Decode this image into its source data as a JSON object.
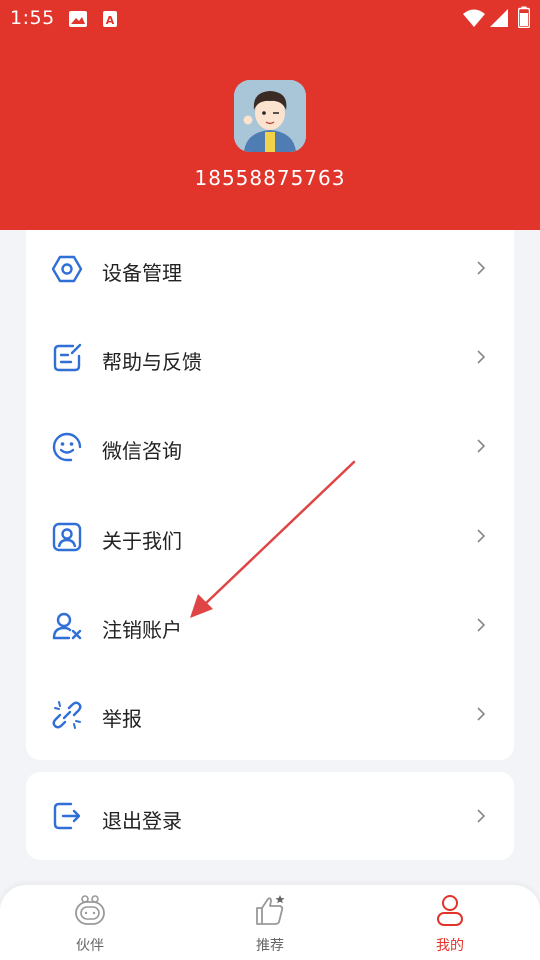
{
  "status_bar": {
    "time": "1:55",
    "icons": [
      "image-icon",
      "app-a-icon",
      "wifi-icon",
      "signal-icon",
      "battery-icon"
    ]
  },
  "colors": {
    "brand_red": "#e1342b",
    "icon_blue": "#2f6fd6",
    "background": "#f3f4f7"
  },
  "profile": {
    "phone": "18558875763"
  },
  "menu": {
    "items": [
      {
        "label": "设备管理",
        "icon": "hexagon-settings-icon"
      },
      {
        "label": "帮助与反馈",
        "icon": "feedback-edit-icon"
      },
      {
        "label": "微信咨询",
        "icon": "smile-chat-icon"
      },
      {
        "label": "关于我们",
        "icon": "user-card-icon"
      },
      {
        "label": "注销账户",
        "icon": "user-remove-icon"
      },
      {
        "label": "举报",
        "icon": "broken-link-icon"
      }
    ],
    "logout": {
      "label": "退出登录",
      "icon": "logout-icon"
    }
  },
  "tabbar": {
    "tabs": [
      {
        "label": "伙伴",
        "icon": "robot-icon",
        "active": false
      },
      {
        "label": "推荐",
        "icon": "thumbs-up-icon",
        "active": false
      },
      {
        "label": "我的",
        "icon": "person-icon",
        "active": true
      }
    ]
  }
}
